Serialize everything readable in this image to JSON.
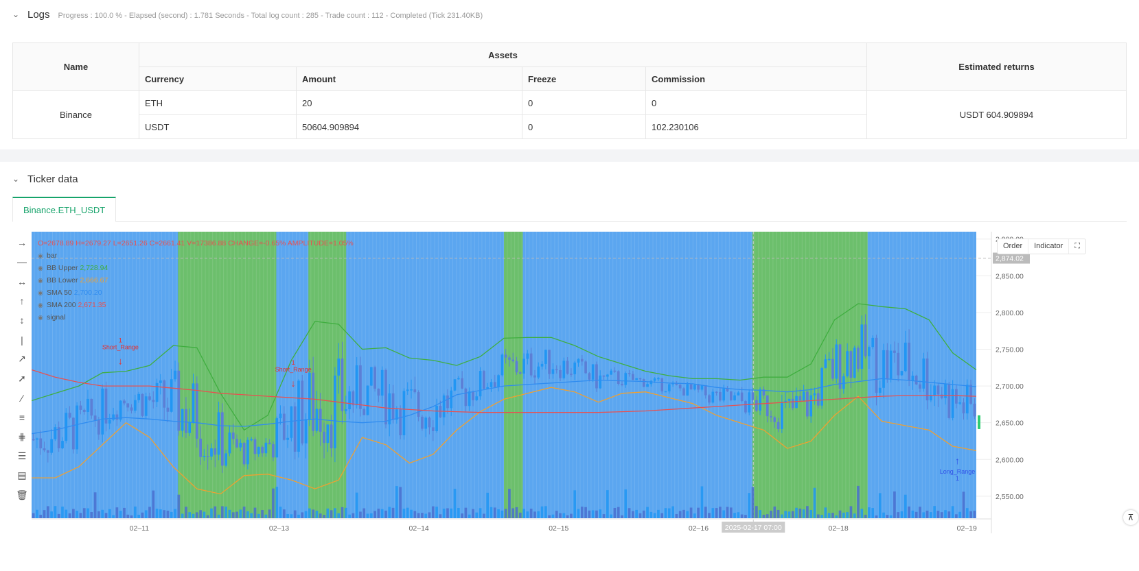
{
  "logs": {
    "title": "Logs",
    "status": "Progress : 100.0 % - Elapsed (second) : 1.781  Seconds - Total log count : 285 - Trade count : 112 - Completed (Tick 231.40KB)"
  },
  "assets_table": {
    "header_name": "Name",
    "header_assets": "Assets",
    "header_returns": "Estimated returns",
    "columns": [
      "Currency",
      "Amount",
      "Freeze",
      "Commission"
    ],
    "exchange": "Binance",
    "rows": [
      {
        "currency": "ETH",
        "amount": "20",
        "freeze": "0",
        "commission": "0"
      },
      {
        "currency": "USDT",
        "amount": "50604.909894",
        "freeze": "0",
        "commission": "102.230106"
      }
    ],
    "estimated_returns": "USDT 604.909894"
  },
  "ticker": {
    "title": "Ticker data",
    "tab_label": "Binance.ETH_USDT",
    "buttons": {
      "order": "Order",
      "indicator": "Indicator"
    },
    "ohlc": {
      "o": "O=2678.89",
      "h": "H=2679.27",
      "l": "L=2651.26",
      "c": "C=2661.41",
      "v": "V=17386.88",
      "change": "CHANGE=-0.65%",
      "amplitude": "AMPLITUDE=1.05%"
    },
    "legend": [
      {
        "name": "bar",
        "value": ""
      },
      {
        "name": "BB Upper",
        "value": "2,728.94"
      },
      {
        "name": "BB Lower",
        "value": "2,666.67"
      },
      {
        "name": "SMA 50",
        "value": "2,700.20"
      },
      {
        "name": "SMA 200",
        "value": "2,671.35"
      },
      {
        "name": "signal",
        "value": ""
      }
    ],
    "current_price_label": "2,874.02",
    "crosshair_time": "2025-02-17 07:00",
    "colors": {
      "bg_blue": "#5ba6f0",
      "bg_green": "#6cbf6c",
      "up": "#2196f3",
      "down": "#5b7fd6",
      "bb_upper": "#3fae3f",
      "bb_lower": "#f0a030",
      "sma50": "#2f8cf0",
      "sma200": "#e85050"
    }
  },
  "chart_data": {
    "type": "candlestick",
    "y_ticks": [
      "2,900.00",
      "2,850.00",
      "2,800.00",
      "2,750.00",
      "2,700.00",
      "2,650.00",
      "2,600.00",
      "2,550.00"
    ],
    "y_tick_values": [
      2900,
      2850,
      2800,
      2750,
      2700,
      2650,
      2600,
      2550
    ],
    "x_ticks": [
      "02–11",
      "02–13",
      "02–14",
      "02–15",
      "02–16",
      "02–18",
      "02–19"
    ],
    "ylim": [
      2520,
      2910
    ],
    "current_price": 2874.02,
    "green_zones": [
      [
        0.155,
        0.259
      ],
      [
        0.293,
        0.333
      ],
      [
        0.5,
        0.52
      ],
      [
        0.763,
        0.885
      ]
    ],
    "bb_upper": [
      2680,
      2690,
      2700,
      2718,
      2720,
      2728,
      2755,
      2752,
      2690,
      2640,
      2660,
      2735,
      2788,
      2784,
      2750,
      2752,
      2738,
      2735,
      2728,
      2740,
      2765,
      2766,
      2766,
      2755,
      2740,
      2730,
      2720,
      2714,
      2710,
      2710,
      2708,
      2712,
      2712,
      2730,
      2790,
      2812,
      2808,
      2805,
      2790,
      2745,
      2722
    ],
    "bb_lower": [
      2575,
      2575,
      2590,
      2620,
      2650,
      2630,
      2590,
      2560,
      2553,
      2578,
      2580,
      2572,
      2560,
      2572,
      2630,
      2620,
      2595,
      2607,
      2640,
      2665,
      2682,
      2690,
      2698,
      2692,
      2678,
      2690,
      2692,
      2684,
      2676,
      2660,
      2650,
      2640,
      2615,
      2625,
      2660,
      2686,
      2652,
      2646,
      2640,
      2618,
      2612
    ],
    "sma50": [
      2635,
      2640,
      2648,
      2655,
      2657,
      2655,
      2652,
      2650,
      2646,
      2645,
      2648,
      2652,
      2655,
      2652,
      2650,
      2652,
      2660,
      2672,
      2688,
      2694,
      2700,
      2702,
      2704,
      2706,
      2708,
      2707,
      2706,
      2704,
      2703,
      2698,
      2695,
      2694,
      2692,
      2695,
      2702,
      2706,
      2710,
      2708,
      2705,
      2702,
      2699
    ],
    "sma200": [
      2722,
      2712,
      2705,
      2700,
      2700,
      2700,
      2697,
      2694,
      2690,
      2688,
      2686,
      2684,
      2682,
      2678,
      2674,
      2670,
      2668,
      2666,
      2665,
      2664,
      2664,
      2664,
      2664,
      2664,
      2664,
      2665,
      2666,
      2668,
      2670,
      2672,
      2674,
      2676,
      2678,
      2680,
      2682,
      2684,
      2686,
      2687,
      2687,
      2687,
      2686
    ],
    "signals": [
      {
        "label": "Short_Range",
        "qty": "1",
        "dir": "down",
        "xr": 0.094,
        "price": 2720
      },
      {
        "label": "Short_Range",
        "qty": "1",
        "dir": "down",
        "xr": 0.277,
        "price": 2690
      },
      {
        "label": "Long_Range",
        "qty": "1",
        "dir": "up",
        "xr": 0.98,
        "price": 2605
      }
    ]
  }
}
